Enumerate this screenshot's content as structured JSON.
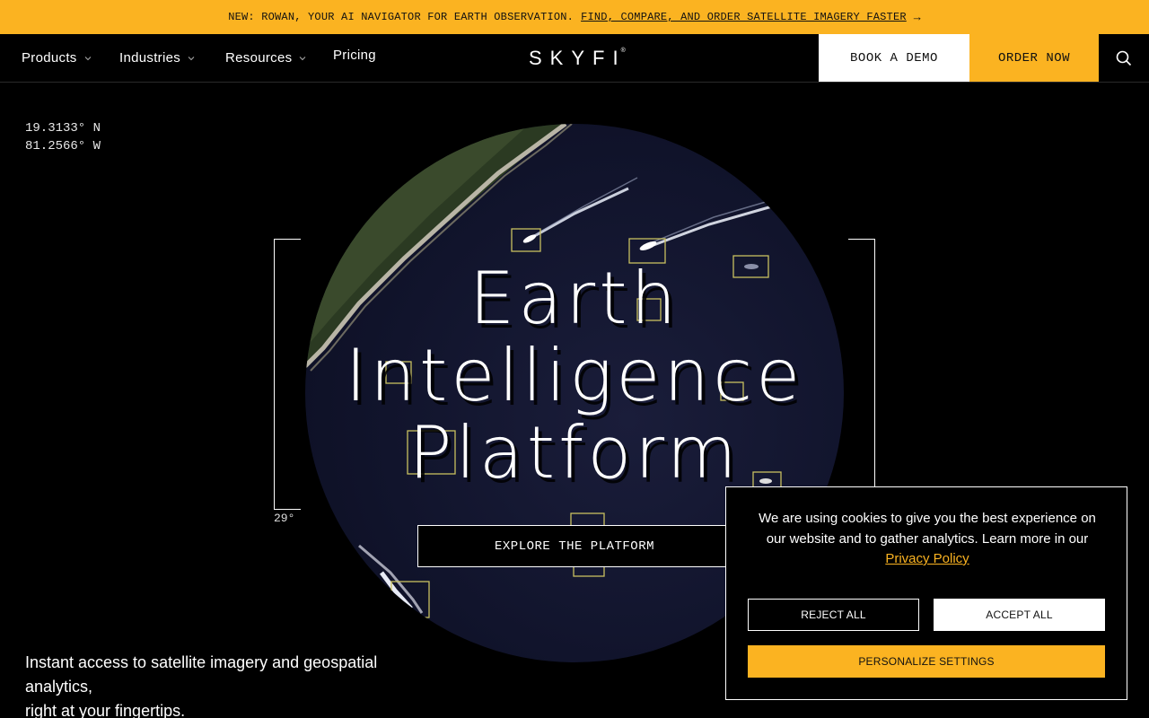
{
  "announcement": {
    "prefix": "NEW: ROWAN, YOUR AI NAVIGATOR FOR EARTH OBSERVATION.",
    "link": "FIND, COMPARE, AND ORDER SATELLITE IMAGERY FASTER",
    "arrow_icon": "arrow-right-icon"
  },
  "nav": {
    "items": [
      {
        "label": "Products",
        "dropdown": true
      },
      {
        "label": "Industries",
        "dropdown": true
      },
      {
        "label": "Resources",
        "dropdown": true
      },
      {
        "label": "Pricing",
        "dropdown": false
      }
    ],
    "logo": "SKYFI",
    "logo_mark": "®",
    "book_demo": "BOOK A DEMO",
    "order_now": "ORDER NOW",
    "search_icon": "search-icon"
  },
  "hero": {
    "lat": "19.3133° N",
    "lon": "81.2566° W",
    "angle": "29°",
    "title_lines": [
      "Earth",
      "Intelligence",
      "Platform"
    ],
    "cta": "EXPLORE THE PLATFORM",
    "tagline_line1": "Instant access to satellite imagery and geospatial analytics,",
    "tagline_line2": "right at your fingertips."
  },
  "cookie": {
    "text": "We are using cookies to give you the best experience on our website and to gather analytics. Learn more in our",
    "link": "Privacy Policy",
    "reject": "REJECT ALL",
    "accept": "ACCEPT ALL",
    "personalize": "PERSONALIZE SETTINGS"
  },
  "colors": {
    "accent": "#fbb321",
    "background": "#000000",
    "detection_box": "#c8c060"
  }
}
